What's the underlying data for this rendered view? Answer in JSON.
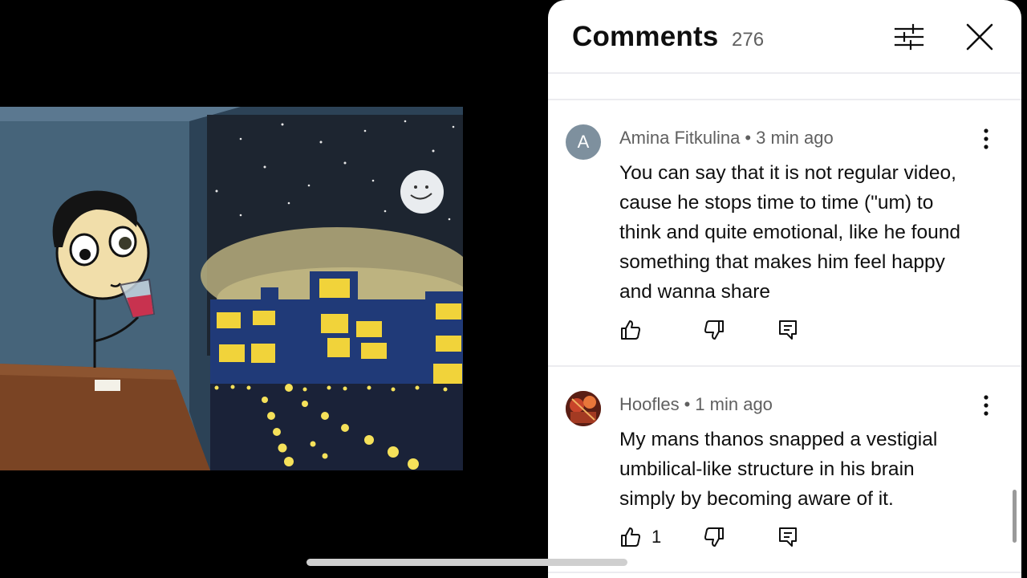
{
  "comments_panel": {
    "title": "Comments",
    "count": "276",
    "filter_icon": "sliders-icon",
    "close_icon": "close-icon",
    "comments": [
      {
        "avatar_letter": "A",
        "avatar_color": "#7e909e",
        "author": "Amina Fitkulina",
        "time": "3 min ago",
        "lines": [
          "You can say that it is not regular video,",
          "cause he stops time to time (\"um) to",
          "think and quite emotional, like he found",
          "something that makes him feel happy",
          "and wanna share"
        ],
        "likes": ""
      },
      {
        "avatar_letter": "",
        "avatar_color": "#7a2a1c",
        "author": "Hoofles",
        "time": "1 min ago",
        "lines": [
          "My mans thanos snapped a vestigial",
          "umbilical-like structure in his brain",
          "simply by becoming aware of it."
        ],
        "likes": "1"
      }
    ]
  },
  "meta_separator": "•"
}
